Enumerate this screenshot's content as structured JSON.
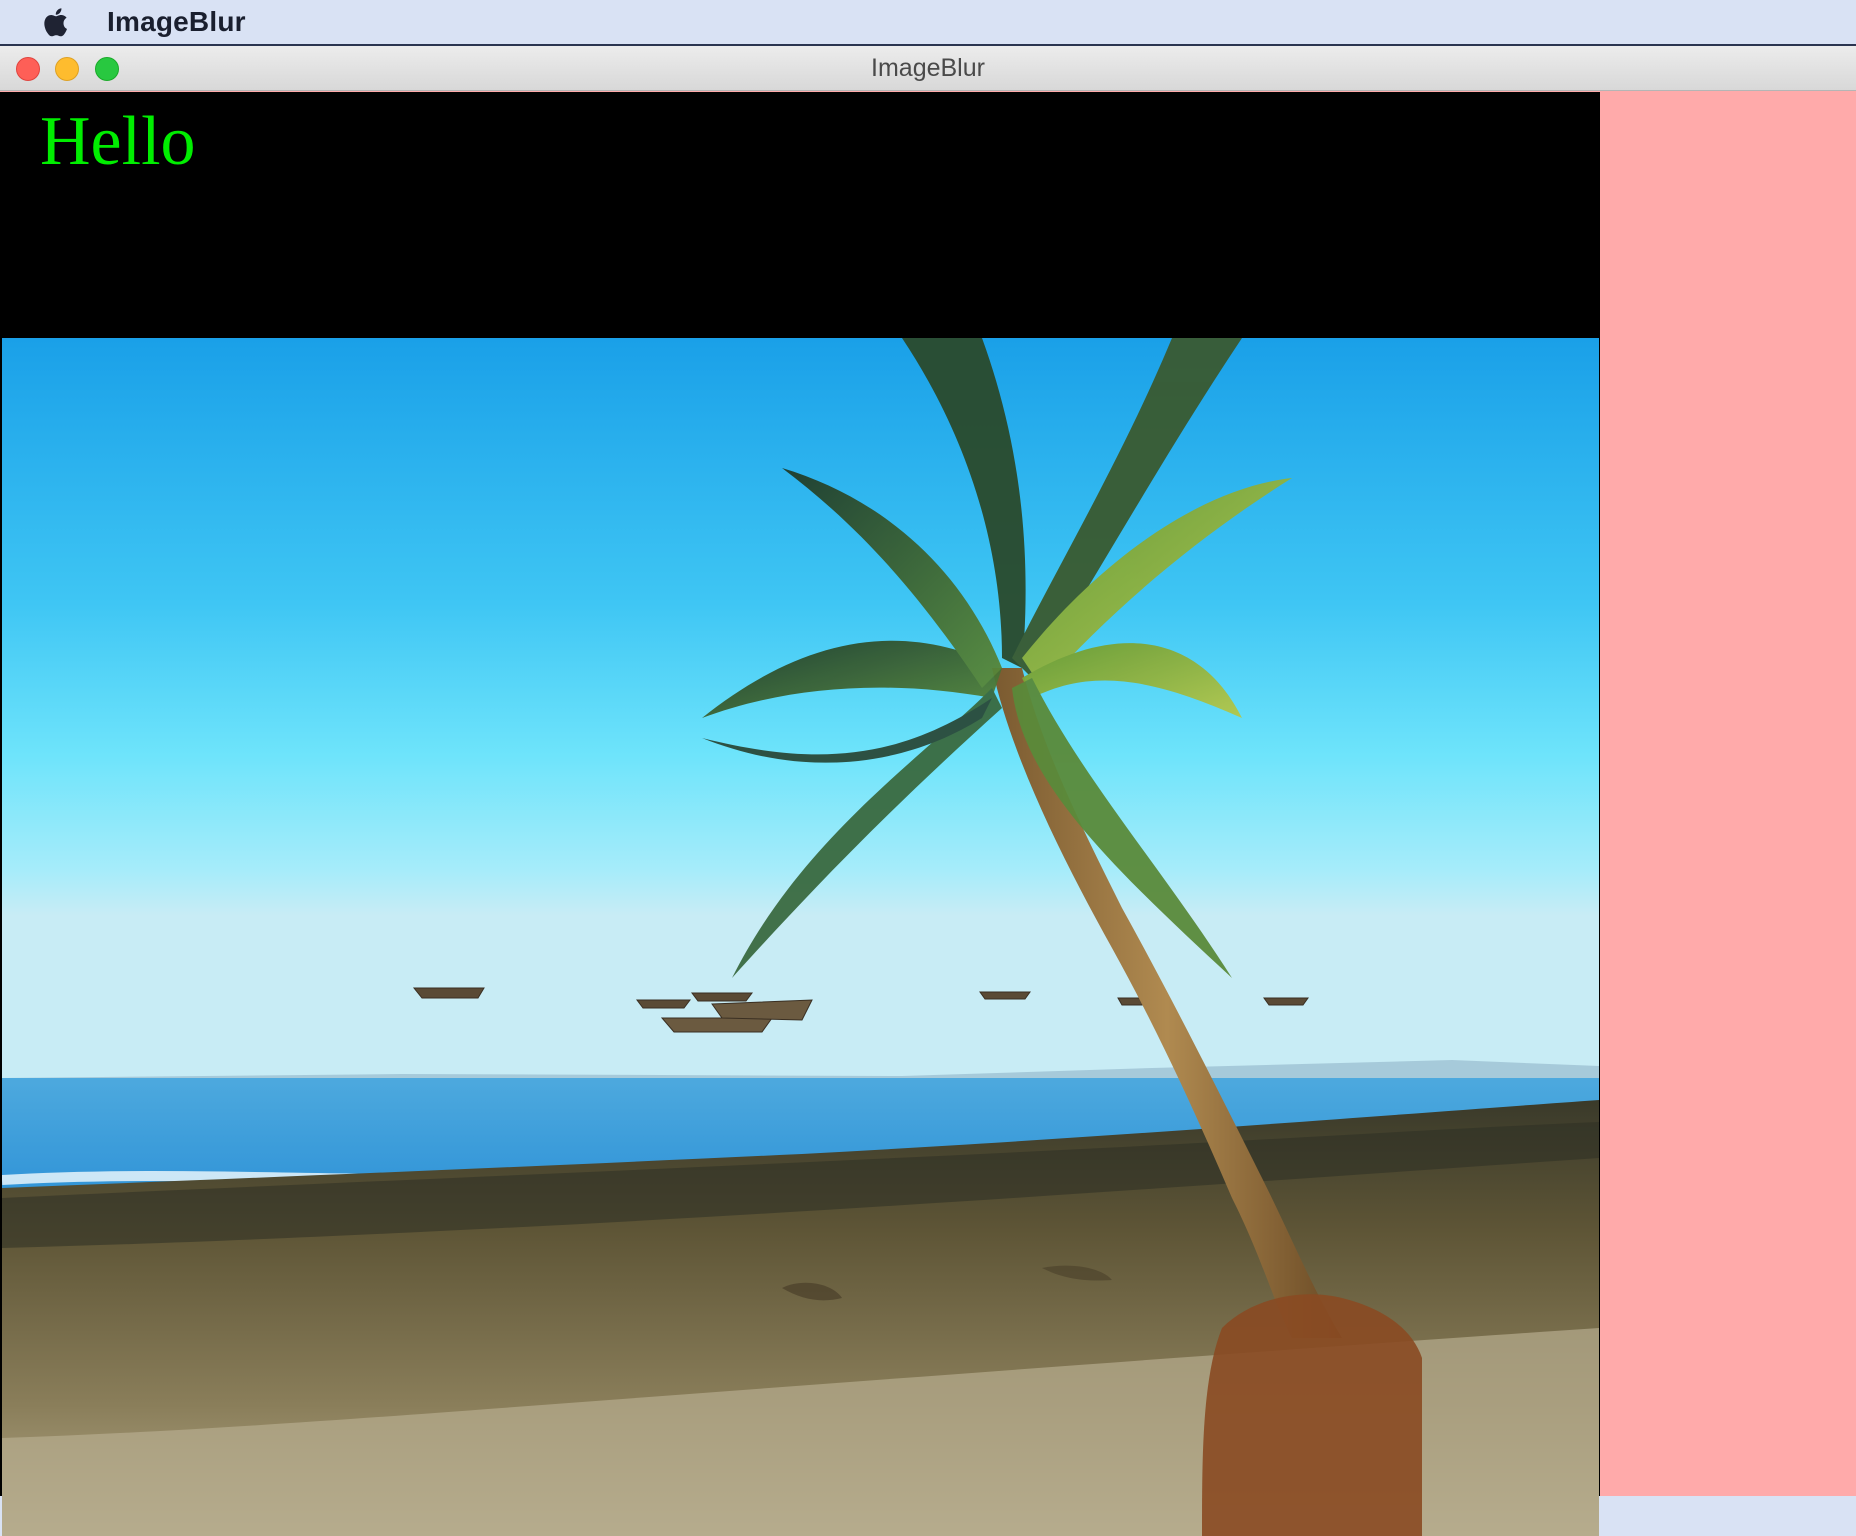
{
  "menubar": {
    "apple_icon": "apple-logo-icon",
    "app_name": "ImageBlur"
  },
  "window": {
    "title": "ImageBlur",
    "buttons": [
      "close",
      "minimize",
      "zoom"
    ],
    "colors": {
      "sidebar_background": "#ffaaaa",
      "header_background": "#000000",
      "hello_color": "#00ee00"
    }
  },
  "content": {
    "greeting": "Hello",
    "image": "beach-palm-tree-photo"
  }
}
